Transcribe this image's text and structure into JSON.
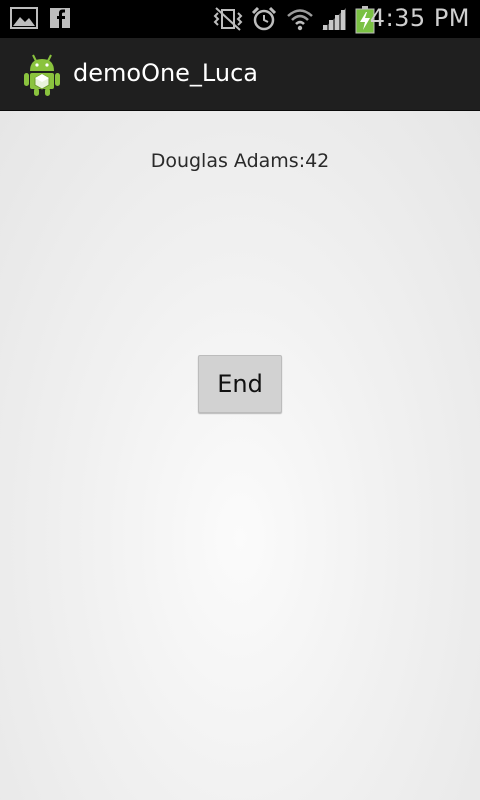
{
  "status_bar": {
    "time": "4:35 PM",
    "left_icons": [
      "gallery-icon",
      "facebook-icon"
    ],
    "right_icons": [
      "vibrate-mute-icon",
      "alarm-icon",
      "wifi-icon",
      "signal-icon",
      "battery-charging-icon"
    ]
  },
  "action_bar": {
    "title": "demoOne_Luca",
    "icon": "android-icon"
  },
  "main": {
    "quote": "Douglas Adams:42",
    "end_button_label": "End"
  },
  "colors": {
    "action_bar_bg": "#1f1f1f",
    "status_bar_bg": "#000000",
    "android_green": "#8ac33e",
    "battery_green": "#7ac143"
  }
}
